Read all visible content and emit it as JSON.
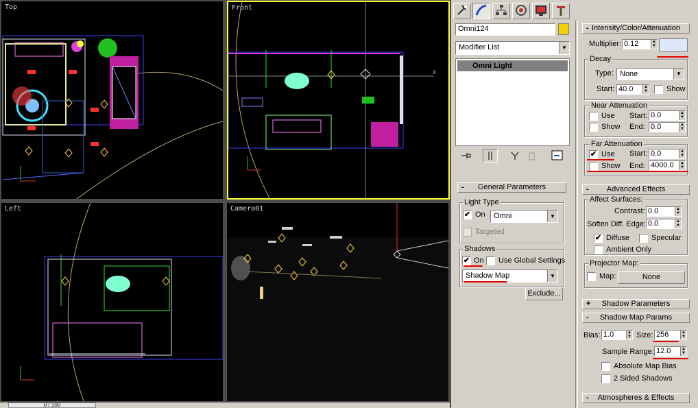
{
  "viewports": {
    "top": {
      "label": "Top"
    },
    "front": {
      "label": "Front"
    },
    "left": {
      "label": "Left"
    },
    "camera": {
      "label": "Camera01"
    }
  },
  "timeline": {
    "slider": "0 / 100"
  },
  "command_panel": {
    "tabs": [
      {
        "icon": "create-icon"
      },
      {
        "icon": "modify-icon"
      },
      {
        "icon": "hierarchy-icon"
      },
      {
        "icon": "motion-icon"
      },
      {
        "icon": "display-icon"
      },
      {
        "icon": "utilities-icon"
      }
    ],
    "object_name": "Omni124",
    "object_color": "#f5d000",
    "modifier_list": "Modifier List",
    "stack_item": "Omni Light"
  },
  "general_parameters": {
    "title": "General Parameters",
    "light_type": {
      "group": "Light Type",
      "on_label": "On",
      "on": true,
      "type": "Omni",
      "targeted_label": "Targeted"
    },
    "shadows": {
      "group": "Shadows",
      "on_label": "On",
      "on": true,
      "global_label": "Use Global Settings",
      "type": "Shadow Map"
    },
    "exclude_button": "Exclude..."
  },
  "intensity": {
    "title": "Intensity/Color/Attenuation",
    "multiplier_label": "Multiplier:",
    "multiplier": "0.12",
    "color": "#dde8fa",
    "decay": {
      "group": "Decay",
      "type_label": "Type:",
      "type": "None",
      "start_label": "Start:",
      "start": "40.0",
      "show_label": "Show"
    },
    "near": {
      "group": "Near Attenuation",
      "use_label": "Use",
      "show_label": "Show",
      "start_label": "Start:",
      "start": "0.0",
      "end_label": "End:",
      "end": "0.0"
    },
    "far": {
      "group": "Far Attenuation",
      "use_label": "Use",
      "use": true,
      "show_label": "Show",
      "start_label": "Start:",
      "start": "0.0",
      "end_label": "End:",
      "end": "4000.0"
    }
  },
  "advanced_effects": {
    "title": "Advanced Effects",
    "affect": {
      "group": "Affect Surfaces:",
      "contrast_label": "Contrast:",
      "contrast": "0.0",
      "soften_label": "Soften Diff. Edge:",
      "soften": "0.0",
      "diffuse_label": "Diffuse",
      "diffuse": true,
      "specular_label": "Specular",
      "specular": false,
      "ambient_label": "Ambient Only"
    },
    "projector": {
      "group": "Projector Map:",
      "map_label": "Map:",
      "map_button": "None"
    }
  },
  "shadow_parameters": {
    "title": "Shadow Parameters",
    "sign": "+"
  },
  "shadow_map_params": {
    "title": "Shadow Map Params",
    "sign": "-",
    "bias_label": "Bias:",
    "bias": "1.0",
    "size_label": "Size:",
    "size": "256",
    "sample_label": "Sample Range:",
    "sample": "12.0",
    "abs_bias_label": "Absolute Map Bias",
    "two_sided_label": "2 Sided Shadows"
  },
  "atmospheres": {
    "title": "Atmospheres & Effects",
    "sign": "-"
  },
  "colors": {
    "accent_yellow": "#ffff33",
    "annotation_red": "#e00000"
  }
}
